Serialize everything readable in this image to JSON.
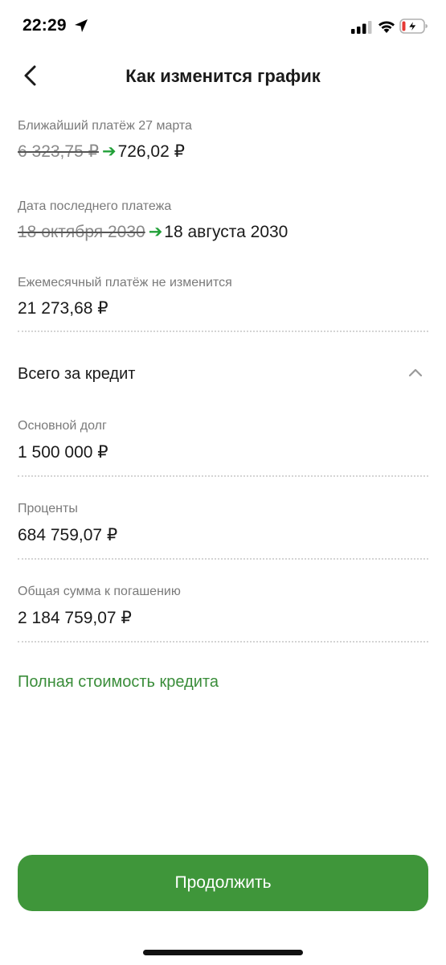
{
  "status_bar": {
    "time": "22:29"
  },
  "header": {
    "title": "Как изменится график"
  },
  "next_payment": {
    "label": "Ближайший платёж 27 марта",
    "old_value": "6 323,75 ₽",
    "arrow": "➔",
    "new_value": "726,02 ₽"
  },
  "last_payment": {
    "label": "Дата последнего платежа",
    "old_value": "18 октября 2030",
    "arrow": "➔",
    "new_value": "18 августа 2030"
  },
  "monthly_payment": {
    "label": "Ежемесячный платёж не изменится",
    "value": "21 273,68 ₽"
  },
  "total_section": {
    "title": "Всего за кредит",
    "items": [
      {
        "label": "Основной долг",
        "value": "1 500 000 ₽"
      },
      {
        "label": "Проценты",
        "value": "684 759,07 ₽"
      },
      {
        "label": "Общая сумма к погашению",
        "value": "2 184 759,07 ₽"
      }
    ]
  },
  "links": {
    "full_cost": "Полная стоимость кредита"
  },
  "buttons": {
    "continue": "Продолжить"
  },
  "colors": {
    "accent_green": "#3f963a",
    "arrow_green": "#21a038",
    "link_green": "#3a8d3a"
  },
  "icons": [
    "location-arrow-icon",
    "signal-icon",
    "wifi-icon",
    "battery-charging-icon",
    "back-arrow-icon",
    "chevron-up-icon"
  ]
}
